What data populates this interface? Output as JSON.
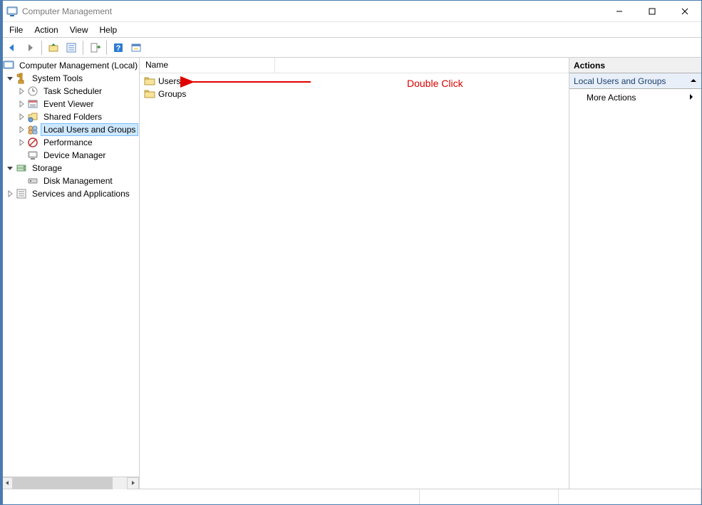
{
  "window": {
    "title": "Computer Management"
  },
  "menu": {
    "file": "File",
    "action": "Action",
    "view": "View",
    "help": "Help"
  },
  "tree": {
    "root": "Computer Management (Local)",
    "system_tools": "System Tools",
    "task_scheduler": "Task Scheduler",
    "event_viewer": "Event Viewer",
    "shared_folders": "Shared Folders",
    "local_users_groups": "Local Users and Groups",
    "performance": "Performance",
    "device_manager": "Device Manager",
    "storage": "Storage",
    "disk_management": "Disk Management",
    "services_apps": "Services and Applications"
  },
  "list": {
    "column_name": "Name",
    "items": [
      {
        "label": "Users"
      },
      {
        "label": "Groups"
      }
    ]
  },
  "actions": {
    "header": "Actions",
    "section": "Local Users and Groups",
    "more": "More Actions"
  },
  "annotation": {
    "text": "Double Click"
  }
}
